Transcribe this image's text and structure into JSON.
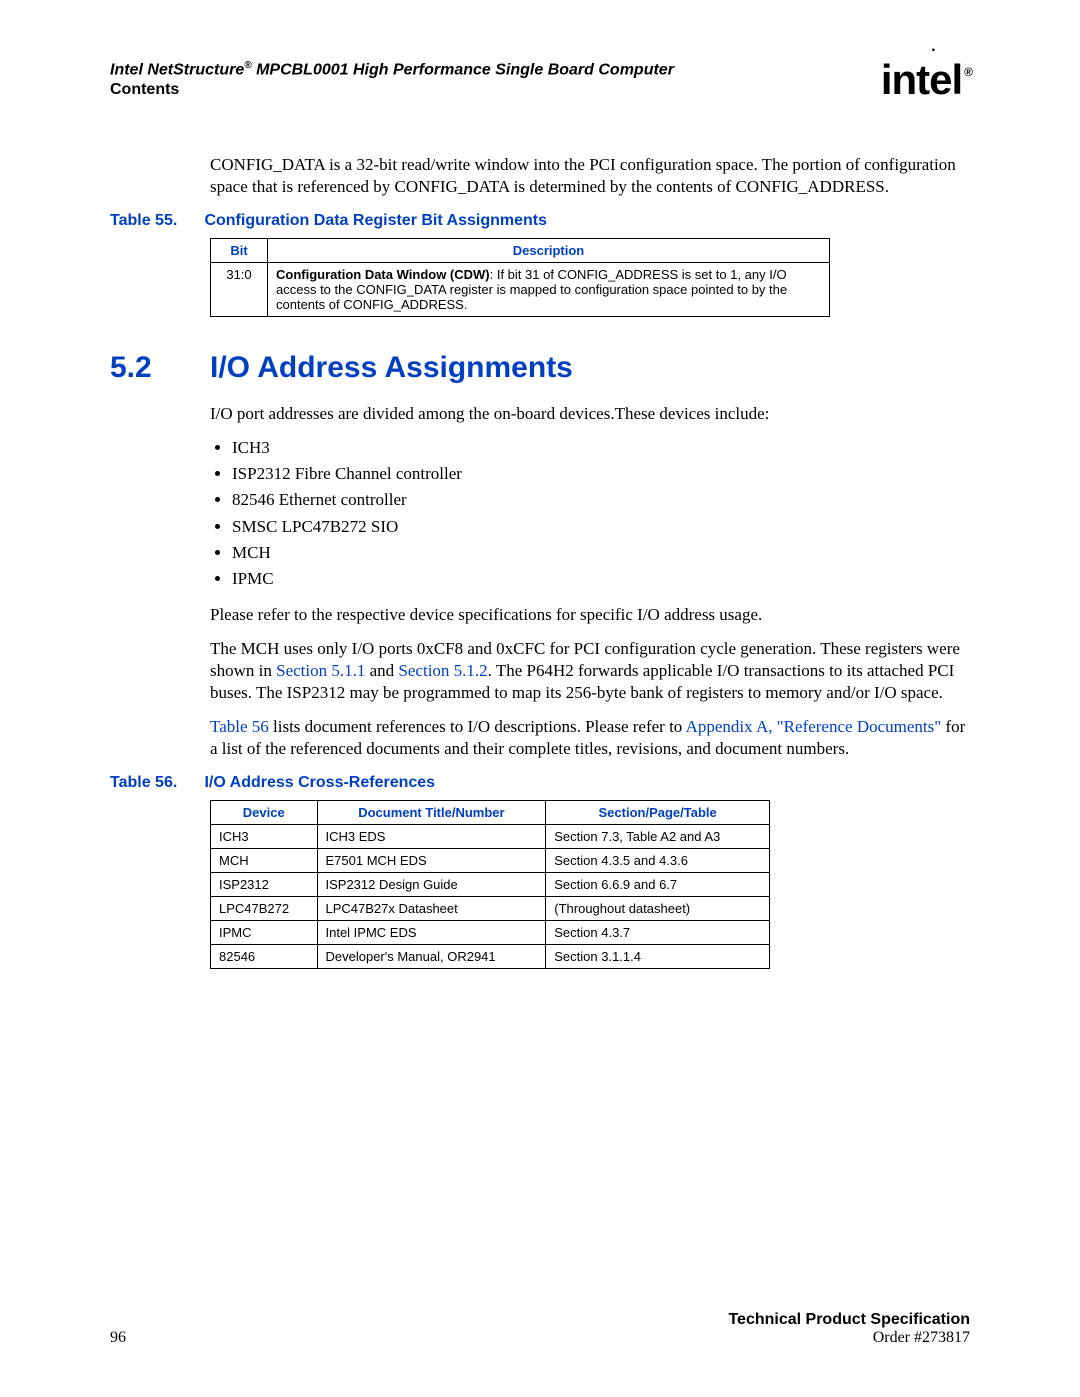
{
  "header": {
    "product_line_prefix": "Intel NetStructure",
    "reg_mark": "®",
    "product_line_suffix": " MPCBL0001 High Performance Single Board Computer",
    "subtitle": "Contents",
    "logo_text": "intel",
    "logo_reg": "®"
  },
  "intro_para": "CONFIG_DATA is a 32-bit read/write window into the PCI configuration space. The portion of configuration space that is referenced by CONFIG_DATA is determined by the contents of CONFIG_ADDRESS.",
  "table55": {
    "label": "Table 55.",
    "title": "Configuration Data Register Bit Assignments",
    "headers": {
      "bit": "Bit",
      "desc": "Description"
    },
    "row": {
      "bit": "31:0",
      "bold": "Configuration Data Window (CDW)",
      "rest": ": If bit 31 of CONFIG_ADDRESS is set to 1, any I/O access to the CONFIG_DATA register is mapped to configuration space pointed to by the contents of CONFIG_ADDRESS."
    }
  },
  "section": {
    "number": "5.2",
    "title": "I/O Address Assignments"
  },
  "para_intro": "I/O port addresses are divided among the on-board devices.These devices include:",
  "devices": [
    "ICH3",
    "ISP2312 Fibre Channel controller",
    "82546 Ethernet controller",
    "SMSC LPC47B272 SIO",
    "MCH",
    "IPMC"
  ],
  "para_refer": "Please refer to the respective device specifications for specific I/O address usage.",
  "para_mch_a": "The MCH uses only I/O ports 0xCF8 and 0xCFC for PCI configuration cycle generation. These registers were shown in ",
  "link_511": "Section 5.1.1",
  "para_mch_b": " and ",
  "link_512": "Section 5.1.2",
  "para_mch_c": ". The P64H2 forwards applicable I/O transactions to its attached PCI buses. The ISP2312 may be programmed to map its 256-byte bank of registers to memory and/or I/O space.",
  "para_t56_a": "",
  "link_t56": "Table 56",
  "para_t56_b": " lists document references to I/O descriptions. Please refer to ",
  "link_appA": "Appendix A, \"Reference Documents\"",
  "para_t56_c": " for a list of the referenced documents and their complete titles, revisions, and document numbers.",
  "table56": {
    "label": "Table 56.",
    "title": "I/O Address Cross-References",
    "headers": {
      "device": "Device",
      "doc": "Document Title/Number",
      "sec": "Section/Page/Table"
    },
    "rows": [
      {
        "device": "ICH3",
        "doc": "ICH3 EDS",
        "sec": "Section 7.3, Table A2 and A3"
      },
      {
        "device": "MCH",
        "doc": "E7501 MCH EDS",
        "sec": "Section 4.3.5 and 4.3.6"
      },
      {
        "device": "ISP2312",
        "doc": "ISP2312 Design Guide",
        "sec": "Section 6.6.9 and 6.7"
      },
      {
        "device": "LPC47B272",
        "doc": "LPC47B27x Datasheet",
        "sec": "(Throughout datasheet)"
      },
      {
        "device": "IPMC",
        "doc": "Intel IPMC EDS",
        "sec": "Section 4.3.7"
      },
      {
        "device": "82546",
        "doc": "Developer's Manual, OR2941",
        "sec": "Section 3.1.1.4"
      }
    ]
  },
  "footer": {
    "page": "96",
    "tps": "Technical Product Specification",
    "order": "Order #273817"
  }
}
